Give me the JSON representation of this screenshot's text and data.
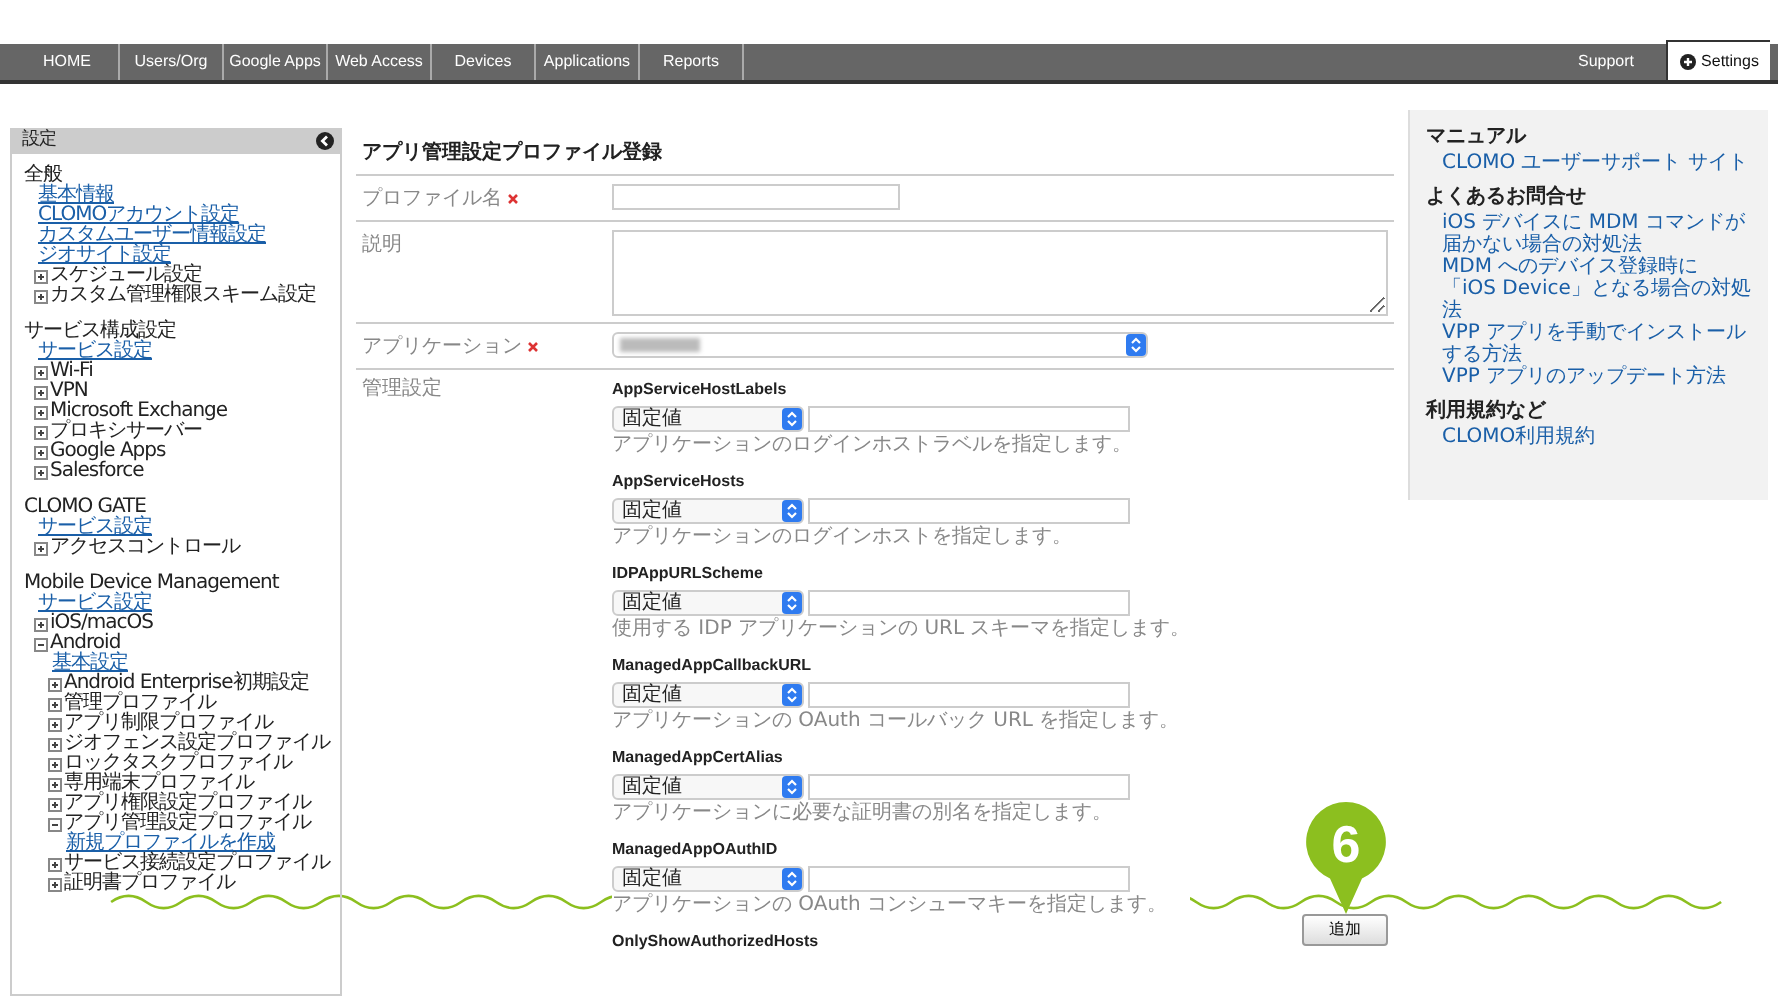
{
  "nav": {
    "tabs": [
      {
        "label": "HOME",
        "selected": false
      },
      {
        "label": "Users/Org",
        "selected": false
      },
      {
        "label": "Google Apps",
        "selected": false
      },
      {
        "label": "Web Access",
        "selected": false
      },
      {
        "label": "Devices",
        "selected": false
      },
      {
        "label": "Applications",
        "selected": false
      },
      {
        "label": "Reports",
        "selected": false
      }
    ],
    "right_tabs": [
      {
        "label": "Support",
        "selected": false
      },
      {
        "label": "Settings",
        "selected": true
      }
    ]
  },
  "sidebar": {
    "title": "設定",
    "sections": [
      {
        "heading": "全般",
        "items": [
          {
            "label": "基本情報",
            "kind": "link"
          },
          {
            "label": "CLOMOアカウント設定",
            "kind": "link"
          },
          {
            "label": "カスタムユーザー情報設定",
            "kind": "link"
          },
          {
            "label": "ジオサイト設定",
            "kind": "link"
          },
          {
            "label": "スケジュール設定",
            "kind": "node",
            "expanded": false
          },
          {
            "label": "カスタム管理権限スキーム設定",
            "kind": "node",
            "expanded": false
          }
        ]
      },
      {
        "heading": "サービス構成設定",
        "items": [
          {
            "label": "サービス設定",
            "kind": "link"
          },
          {
            "label": "Wi-Fi",
            "kind": "node",
            "expanded": false
          },
          {
            "label": "VPN",
            "kind": "node",
            "expanded": false
          },
          {
            "label": "Microsoft Exchange",
            "kind": "node",
            "expanded": false
          },
          {
            "label": "プロキシサーバー",
            "kind": "node",
            "expanded": false
          },
          {
            "label": "Google Apps",
            "kind": "node",
            "expanded": false
          },
          {
            "label": "Salesforce",
            "kind": "node",
            "expanded": false
          }
        ]
      },
      {
        "heading": "CLOMO GATE",
        "items": [
          {
            "label": "サービス設定",
            "kind": "link"
          },
          {
            "label": "アクセスコントロール",
            "kind": "node",
            "expanded": false
          }
        ]
      },
      {
        "heading": "Mobile Device Management",
        "items": [
          {
            "label": "サービス設定",
            "kind": "link"
          },
          {
            "label": "iOS/macOS",
            "kind": "node",
            "expanded": false
          },
          {
            "label": "Android",
            "kind": "node",
            "expanded": true,
            "children": [
              {
                "label": "基本設定",
                "kind": "link"
              },
              {
                "label": "Android Enterprise初期設定",
                "kind": "node",
                "expanded": false
              },
              {
                "label": "管理プロファイル",
                "kind": "node",
                "expanded": false
              },
              {
                "label": "アプリ制限プロファイル",
                "kind": "node",
                "expanded": false
              },
              {
                "label": "ジオフェンス設定プロファイル",
                "kind": "node",
                "expanded": false
              },
              {
                "label": "ロックタスクプロファイル",
                "kind": "node",
                "expanded": false
              },
              {
                "label": "専用端末プロファイル",
                "kind": "node",
                "expanded": false
              },
              {
                "label": "アプリ権限設定プロファイル",
                "kind": "node",
                "expanded": false
              },
              {
                "label": "アプリ管理設定プロファイル",
                "kind": "node",
                "expanded": true,
                "children": [
                  {
                    "label": "新規プロファイルを作成",
                    "kind": "link"
                  }
                ]
              },
              {
                "label": "サービス接続設定プロファイル",
                "kind": "node",
                "expanded": false
              },
              {
                "label": "証明書プロファイル",
                "kind": "node",
                "expanded": false
              }
            ]
          }
        ]
      }
    ]
  },
  "form": {
    "title": "アプリ管理設定プロファイル登録",
    "fields": [
      {
        "label": "プロファイル名",
        "required": true,
        "kind": "input"
      },
      {
        "label": "説明",
        "required": false,
        "kind": "textarea"
      },
      {
        "label": "アプリケーション",
        "required": true,
        "kind": "select"
      }
    ],
    "settings_label": "管理設定",
    "settings": [
      {
        "key": "AppServiceHostLabels",
        "mode": "固定値",
        "hint": "アプリケーションのログインホストラベルを指定します。"
      },
      {
        "key": "AppServiceHosts",
        "mode": "固定値",
        "hint": "アプリケーションのログインホストを指定します。"
      },
      {
        "key": "IDPAppURLScheme",
        "mode": "固定値",
        "hint": "使用する IDP アプリケーションの URL スキーマを指定します。"
      },
      {
        "key": "ManagedAppCallbackURL",
        "mode": "固定値",
        "hint": "アプリケーションの OAuth コールバック URL を指定します。"
      },
      {
        "key": "ManagedAppCertAlias",
        "mode": "固定値",
        "hint": "アプリケーションに必要な証明書の別名を指定します。"
      },
      {
        "key": "ManagedAppOAuthID",
        "mode": "固定値",
        "hint": "アプリケーションの OAuth コンシューマキーを指定します。"
      },
      {
        "key": "OnlyShowAuthorizedHosts"
      }
    ],
    "submit": "追加",
    "callout": "6"
  },
  "help": [
    {
      "heading": "マニュアル",
      "links": [
        "CLOMO ユーザーサポート サイト"
      ]
    },
    {
      "heading": "よくあるお問合せ",
      "links": [
        "iOS デバイスに MDM コマンドが届かない場合の対処法",
        "MDM へのデバイス登録時に「iOS Device」となる場合の対処法",
        "VPP アプリを手動でインストールする方法",
        "VPP アプリのアップデート方法"
      ]
    },
    {
      "heading": "利用規約など",
      "links": [
        "CLOMO利用規約"
      ]
    }
  ]
}
